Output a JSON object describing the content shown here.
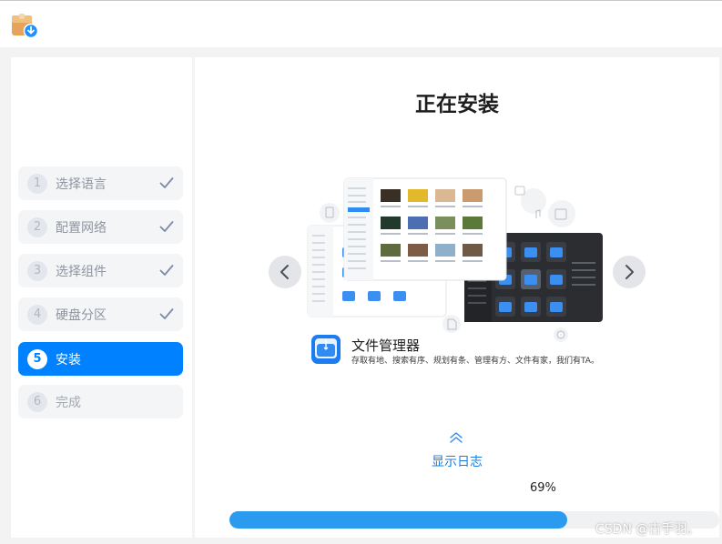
{
  "window": {
    "app_icon": "installer-box-download-icon"
  },
  "sidebar": {
    "steps": [
      {
        "num": "1",
        "label": "选择语言",
        "state": "done"
      },
      {
        "num": "2",
        "label": "配置网络",
        "state": "done"
      },
      {
        "num": "3",
        "label": "选择组件",
        "state": "done"
      },
      {
        "num": "4",
        "label": "硬盘分区",
        "state": "done"
      },
      {
        "num": "5",
        "label": "安装",
        "state": "active"
      },
      {
        "num": "6",
        "label": "完成",
        "state": "pending"
      }
    ]
  },
  "main": {
    "title": "正在安装",
    "slide": {
      "app_icon": "file-manager-icon",
      "title": "文件管理器",
      "description": "存取有地、搜索有序、规划有条、管理有方、文件有家，我们有TA。"
    },
    "log": {
      "label": "显示日志",
      "icon": "double-chevron-up-icon"
    },
    "progress": {
      "percent_text": "69%",
      "value": 0.69
    }
  },
  "watermark": "CSDN @古手羽。",
  "colors": {
    "accent": "#0081ff",
    "progress": "#2b9bf0",
    "link": "#1a7ee0",
    "check": "#7e8aa8"
  }
}
